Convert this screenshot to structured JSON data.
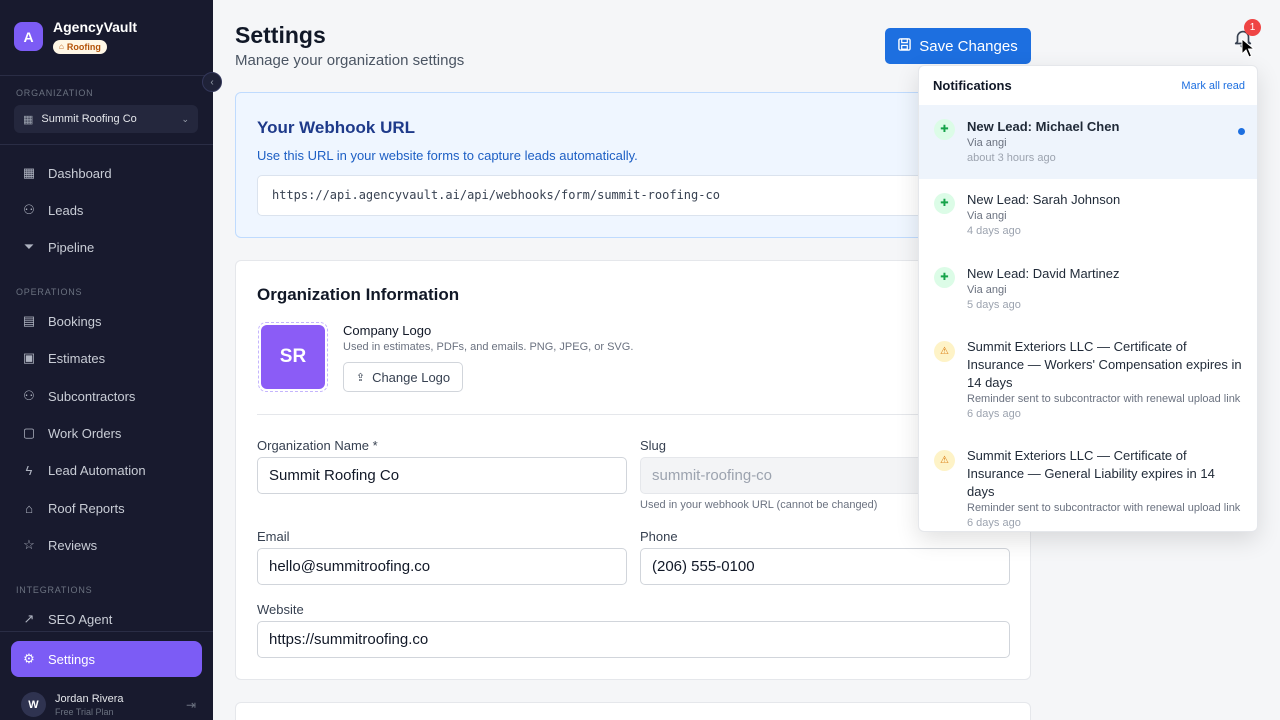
{
  "brand": {
    "initial": "A",
    "name": "AgencyVault",
    "badge": "Roofing"
  },
  "sidebar": {
    "org_section_label": "ORGANIZATION",
    "org_name": "Summit Roofing Co",
    "nav_main": [
      {
        "label": "Dashboard",
        "icon": "dashboard-icon"
      },
      {
        "label": "Leads",
        "icon": "users-icon"
      },
      {
        "label": "Pipeline",
        "icon": "funnel-icon"
      }
    ],
    "operations_label": "OPERATIONS",
    "nav_operations": [
      {
        "label": "Bookings",
        "icon": "calendar-icon"
      },
      {
        "label": "Estimates",
        "icon": "calculator-icon"
      },
      {
        "label": "Subcontractors",
        "icon": "users-icon"
      },
      {
        "label": "Work Orders",
        "icon": "clipboard-icon"
      },
      {
        "label": "Lead Automation",
        "icon": "zap-icon"
      },
      {
        "label": "Roof Reports",
        "icon": "home-icon"
      },
      {
        "label": "Reviews",
        "icon": "star-icon"
      }
    ],
    "integrations_label": "INTEGRATIONS",
    "nav_integrations": [
      {
        "label": "SEO Agent",
        "icon": "trending-icon"
      },
      {
        "label": "Settings",
        "icon": "gear-icon",
        "active": true
      }
    ],
    "user": {
      "initial": "W",
      "name": "Jordan Rivera",
      "plan": "Free Trial Plan"
    }
  },
  "header": {
    "title": "Settings",
    "subtitle": "Manage your organization settings",
    "save_label": "Save Changes",
    "notification_count": "1"
  },
  "webhook": {
    "title": "Your Webhook URL",
    "description": "Use this URL in your website forms to capture leads automatically.",
    "url": "https://api.agencyvault.ai/api/webhooks/form/summit-roofing-co"
  },
  "org_info": {
    "title": "Organization Information",
    "logo_initials": "SR",
    "logo_label": "Company Logo",
    "logo_help": "Used in estimates, PDFs, and emails. PNG, JPEG, or SVG.",
    "change_logo_label": "Change Logo",
    "name_label": "Organization Name *",
    "name_value": "Summit Roofing Co",
    "slug_label": "Slug",
    "slug_value": "summit-roofing-co",
    "slug_help": "Used in your webhook URL (cannot be changed)",
    "email_label": "Email",
    "email_value": "hello@summitroofing.co",
    "phone_label": "Phone",
    "phone_value": "(206) 555-0100",
    "website_label": "Website",
    "website_value": "https://summitroofing.co"
  },
  "notifications": {
    "title": "Notifications",
    "mark_all_read": "Mark all read",
    "items": [
      {
        "type": "lead",
        "title": "New Lead: Michael Chen",
        "sub": "Via angi",
        "time": "about 3 hours ago",
        "unread": true
      },
      {
        "type": "lead",
        "title": "New Lead: Sarah Johnson",
        "sub": "Via angi",
        "time": "4 days ago",
        "unread": false
      },
      {
        "type": "lead",
        "title": "New Lead: David Martinez",
        "sub": "Via angi",
        "time": "5 days ago",
        "unread": false
      },
      {
        "type": "warn",
        "title": "Summit Exteriors LLC — Certificate of Insurance — Workers' Compensation expires in 14 days",
        "sub": "Reminder sent to subcontractor with renewal upload link",
        "time": "6 days ago",
        "unread": false
      },
      {
        "type": "warn",
        "title": "Summit Exteriors LLC — Certificate of Insurance — General Liability expires in 14 days",
        "sub": "Reminder sent to subcontractor with renewal upload link",
        "time": "6 days ago",
        "unread": false
      }
    ]
  }
}
